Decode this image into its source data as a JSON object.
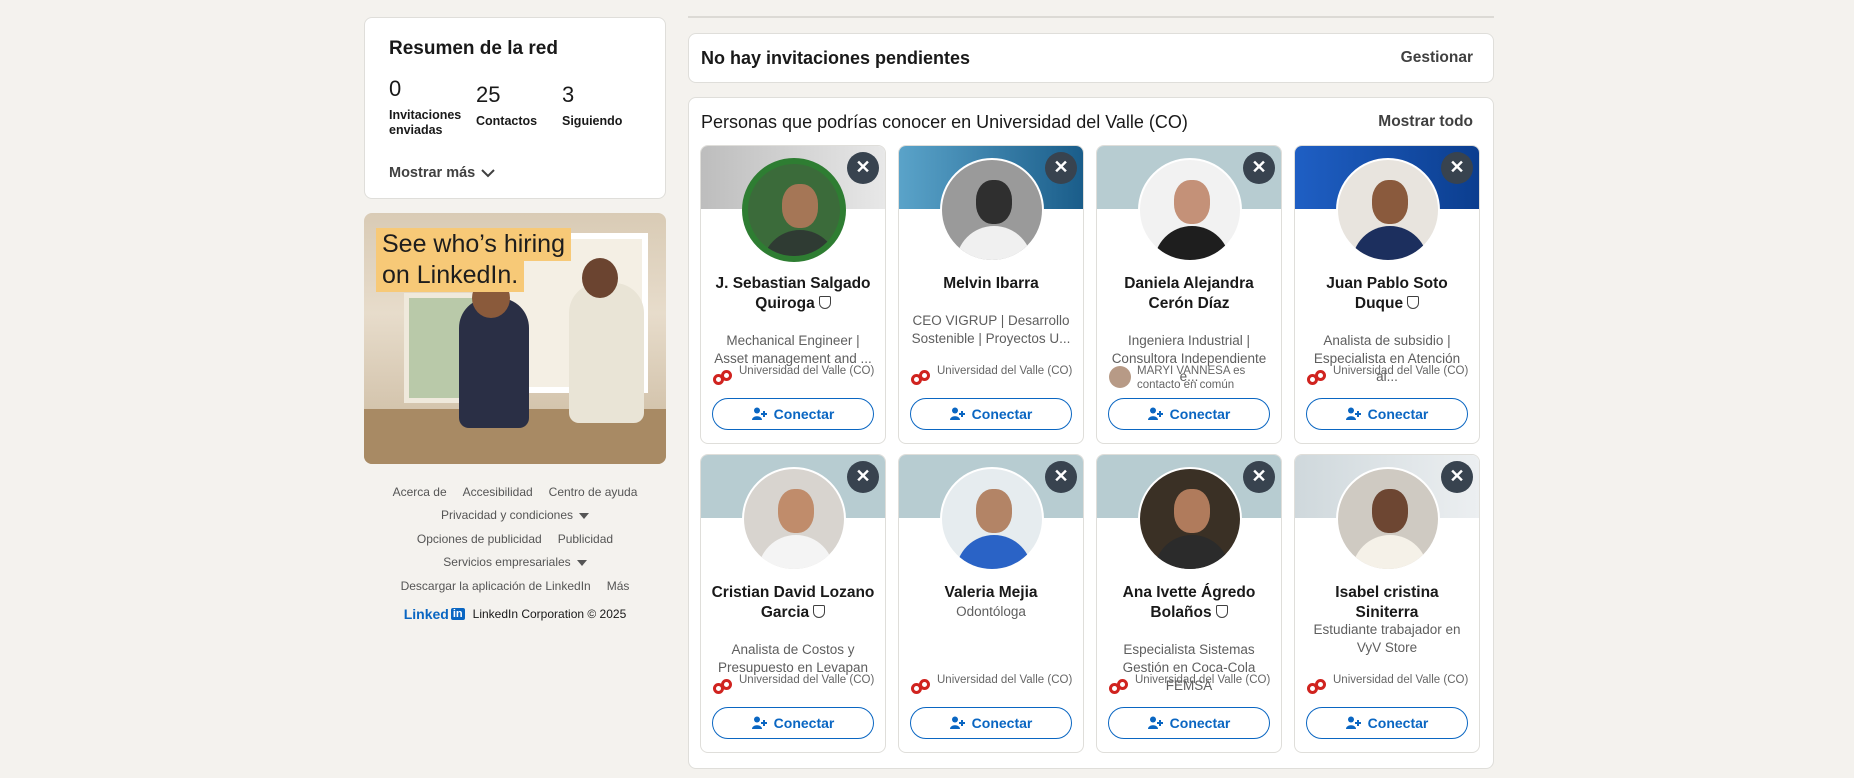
{
  "summary": {
    "title": "Resumen de la red",
    "stats": [
      {
        "num": "0",
        "label": "Invitaciones enviadas"
      },
      {
        "num": "25",
        "label": "Contactos"
      },
      {
        "num": "3",
        "label": "Siguiendo"
      }
    ],
    "more": "Mostrar más"
  },
  "ad": {
    "line1": "See who’s hiring",
    "line2": "on LinkedIn."
  },
  "footer": {
    "links": {
      "about": "Acerca de",
      "accessibility": "Accesibilidad",
      "help": "Centro de ayuda",
      "privacy": "Privacidad y condiciones",
      "adchoices": "Opciones de publicidad",
      "advertising": "Publicidad",
      "business": "Servicios empresariales",
      "app": "Descargar la aplicación de LinkedIn",
      "more": "Más"
    },
    "logo": "Linked",
    "logo_in": "in",
    "copyright": "LinkedIn Corporation © 2025"
  },
  "invites": {
    "title": "No hay invitaciones pendientes",
    "manage": "Gestionar"
  },
  "people": {
    "title": "Personas que podrías conocer en Universidad del Valle (CO)",
    "show_all": "Mostrar todo",
    "connect": "Conectar",
    "cards": [
      {
        "name": "J. Sebastian Salgado Quiroga",
        "desc": "Mechanical Engineer | Asset management and ...",
        "info": "Universidad del Valle (CO)"
      },
      {
        "name": "Melvin Ibarra",
        "desc": "CEO VIGRUP | Desarrollo Sostenible | Proyectos U...",
        "info": "Universidad del Valle (CO)"
      },
      {
        "name": "Daniela Alejandra Cerón Díaz",
        "desc": "Ingeniera Industrial | Consultora Independiente e...",
        "info": "MARYI VANNESA es contacto en común"
      },
      {
        "name": "Juan Pablo Soto Duque",
        "desc": "Analista de subsidio | Especialista en Atención al...",
        "info": "Universidad del Valle (CO)"
      },
      {
        "name": "Cristian David Lozano Garcia",
        "desc": "Analista de Costos y Presupuesto en Levapan",
        "info": "Universidad del Valle (CO)"
      },
      {
        "name": "Valeria Mejia",
        "desc": "Odontóloga",
        "info": "Universidad del Valle (CO)"
      },
      {
        "name": "Ana Ivette Ágredo Bolaños",
        "desc": "Especialista Sistemas Gestión en Coca-Cola FEMSA",
        "info": "Universidad del Valle (CO)"
      },
      {
        "name": "Isabel cristina Siniterra",
        "desc": "Estudiante trabajador en VyV Store",
        "info": "Universidad del Valle (CO)"
      }
    ]
  },
  "colors": {
    "accent": "#0a66c2",
    "page_bg": "#f4f2ee",
    "dismiss_bg": "#38434f",
    "univalle_red": "#d0231f"
  },
  "icons": [
    "close-icon",
    "add-person-icon",
    "verified-shield-icon",
    "chevron-down-icon",
    "univalle-logo-icon"
  ]
}
